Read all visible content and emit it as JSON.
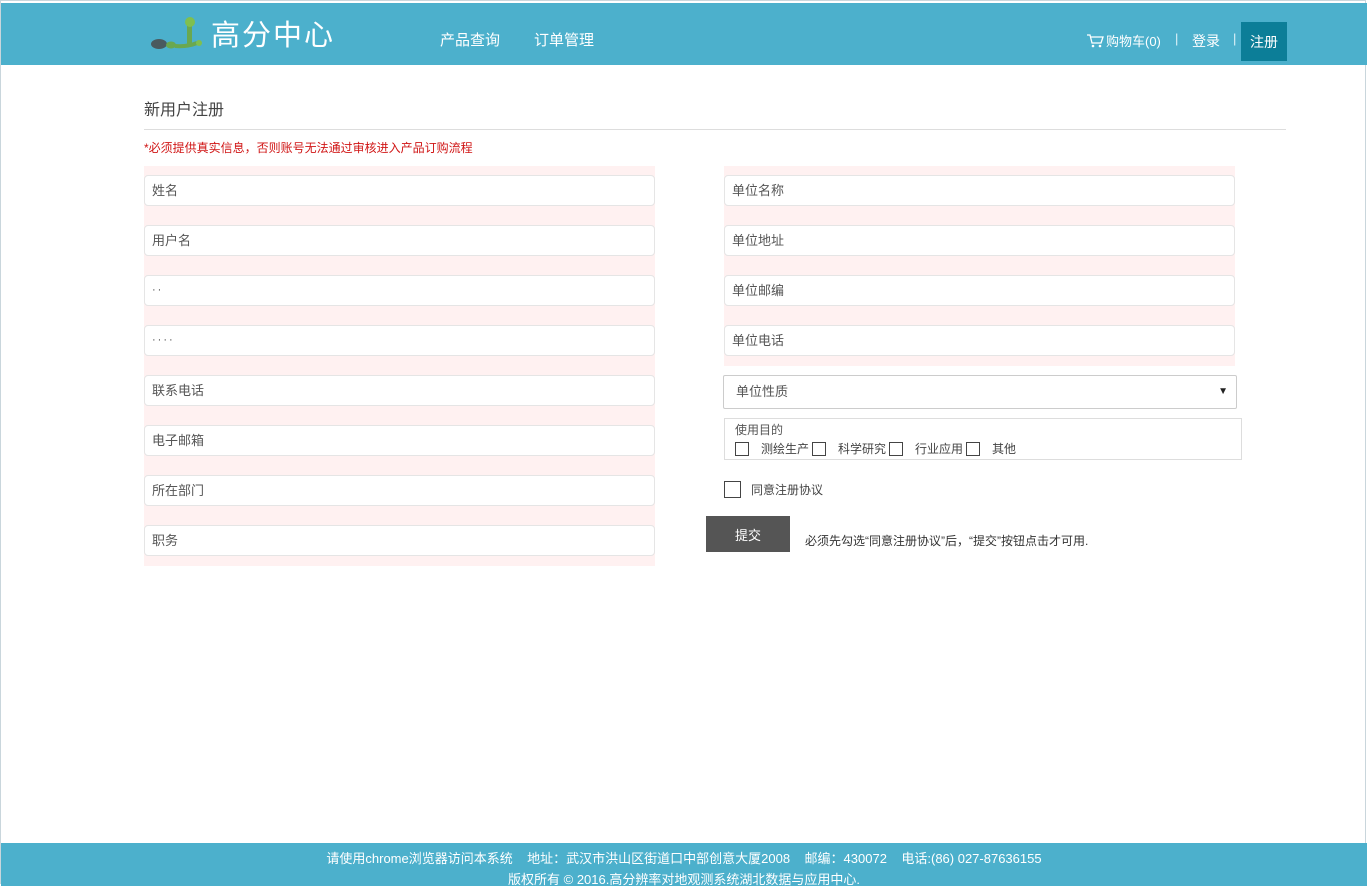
{
  "header": {
    "logo_text": "高分中心",
    "nav": [
      "产品查询",
      "订单管理"
    ],
    "cart_label": "购物车(0)",
    "separator": "|",
    "login_label": "登录",
    "register_label": "注册",
    "colors": {
      "bar": "#4cb0cc",
      "active": "#0c7e98"
    }
  },
  "page": {
    "title": "新用户注册",
    "notice": "*必须提供真实信息，否则账号无法通过审核进入产品订购流程"
  },
  "left_fields": [
    {
      "placeholder": "姓名",
      "value": ""
    },
    {
      "placeholder": "用户名",
      "value": ""
    },
    {
      "placeholder": "",
      "value": "··"
    },
    {
      "placeholder": "",
      "value": "····"
    },
    {
      "placeholder": "联系电话",
      "value": ""
    },
    {
      "placeholder": "电子邮箱",
      "value": ""
    },
    {
      "placeholder": "所在部门",
      "value": ""
    },
    {
      "placeholder": "职务",
      "value": ""
    }
  ],
  "right_fields": [
    {
      "placeholder": "单位名称",
      "value": ""
    },
    {
      "placeholder": "单位地址",
      "value": ""
    },
    {
      "placeholder": "单位邮编",
      "value": ""
    },
    {
      "placeholder": "单位电话",
      "value": ""
    }
  ],
  "unit_type": {
    "selected": "单位性质",
    "arrow": "▼"
  },
  "purpose": {
    "label": "使用目的",
    "options": [
      "测绘生产",
      "科学研究",
      "行业应用",
      "其他"
    ]
  },
  "agreement": {
    "label": "同意注册协议"
  },
  "submit": {
    "label": "提交",
    "hint": "必须先勾选“同意注册协议”后，“提交”按钮点击才可用."
  },
  "footer": {
    "line1": "请使用chrome浏览器访问本系统    地址：武汉市洪山区街道口中部创意大厦2008    邮编：430072    电话:(86) 027-87636155",
    "line2": "版权所有 © 2016.高分辨率对地观测系统湖北数据与应用中心."
  }
}
